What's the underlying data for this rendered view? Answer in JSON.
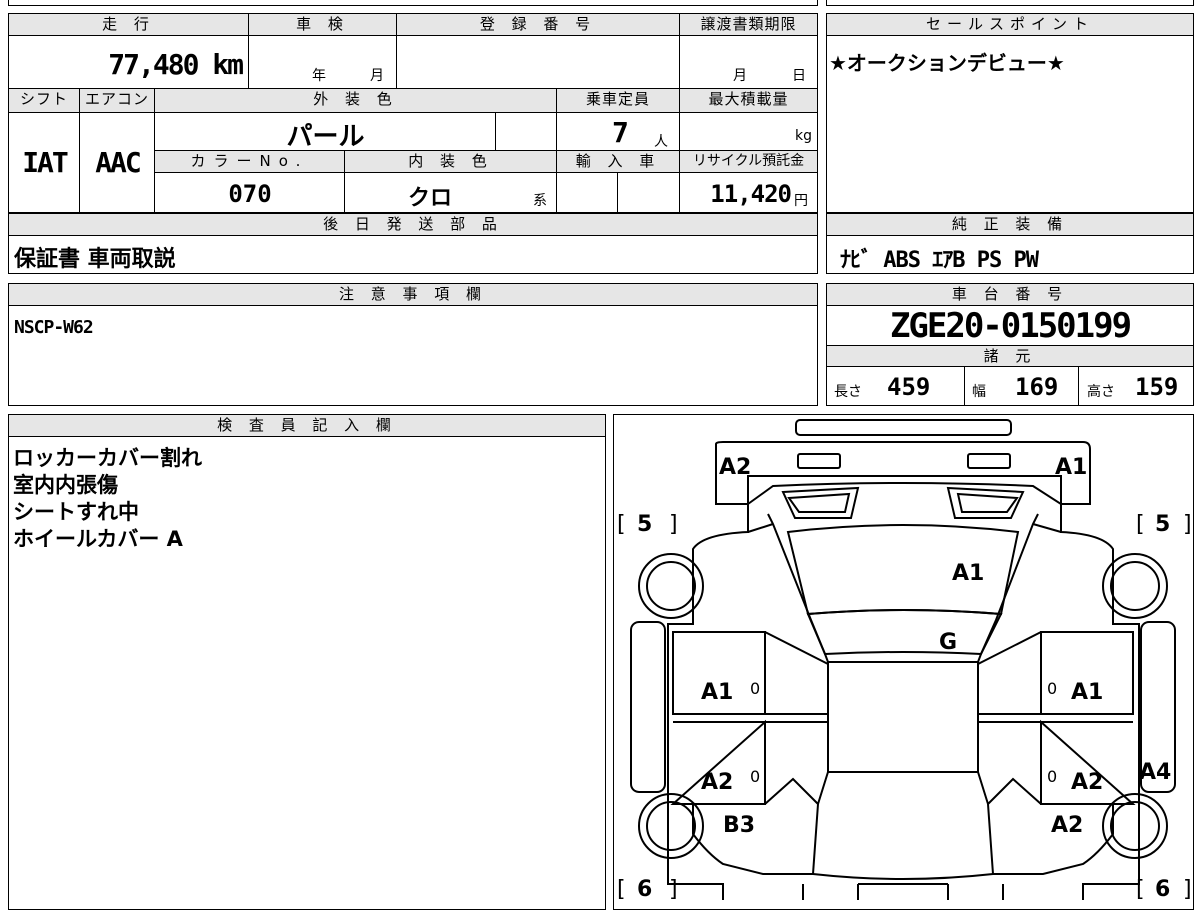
{
  "vehicle": {
    "mileage_label": "走 行",
    "mileage": "77,480 km",
    "inspection_label": "車 検",
    "inspection_year_unit": "年",
    "inspection_month_unit": "月",
    "registration_label": "登 録 番 号",
    "transfer_deadline_label": "譲渡書類期限",
    "transfer_month_unit": "月",
    "transfer_day_unit": "日",
    "shift_label": "シフト",
    "shift": "IAT",
    "ac_label": "エアコン",
    "ac": "AAC",
    "exterior_color_label": "外 装 色",
    "exterior_color": "パール",
    "capacity_label": "乗車定員",
    "capacity": "7",
    "capacity_unit": "人",
    "max_load_label": "最大積載量",
    "max_load_unit": "kg",
    "color_no_label": "カラーNo.",
    "color_no": "070",
    "interior_color_label": "内 装 色",
    "interior_color": "クロ",
    "interior_color_unit": "系",
    "import_label": "輸 入 車",
    "recycle_label": "リサイクル預託金",
    "recycle_fee": "11,420",
    "recycle_unit": "円",
    "accessories_label": "後 日 発 送 部 品",
    "accessories": "保証書 車両取説"
  },
  "sales_point": {
    "label": "セールスポイント",
    "text": "★オークションデビュー★"
  },
  "equipment": {
    "label": "純 正 装 備",
    "text": "ﾅﾋﾞ ABS ｴｱB PS PW"
  },
  "notes": {
    "label": "注 意 事 項 欄",
    "text": "NSCP-W62"
  },
  "chassis": {
    "label": "車 台 番 号",
    "number": "ZGE20-0150199",
    "specs_label": "諸 元",
    "length_label": "長さ",
    "length": "459",
    "width_label": "幅",
    "width": "169",
    "height_label": "高さ",
    "height": "159"
  },
  "inspector": {
    "label": "検 査 員 記 入 欄",
    "lines": [
      "ロッカーカバー割れ",
      "室内内張傷",
      "シートすれ中",
      "ホイールカバー A"
    ]
  },
  "diagram": {
    "marks": {
      "front_left": "A2",
      "front_right": "A1",
      "tire_fl": "5",
      "tire_fr": "5",
      "tire_rl": "6",
      "tire_rr": "6",
      "windshield": "A1",
      "roof": "G",
      "door_fl": "A1",
      "door_fr": "A1",
      "door_rl": "A2",
      "door_rr": "A2",
      "quarter_l": "B3",
      "quarter_r": "A2",
      "side_r": "A4",
      "zero_fl": "0",
      "zero_fr": "0",
      "zero_rl": "0",
      "zero_rr": "0"
    }
  }
}
